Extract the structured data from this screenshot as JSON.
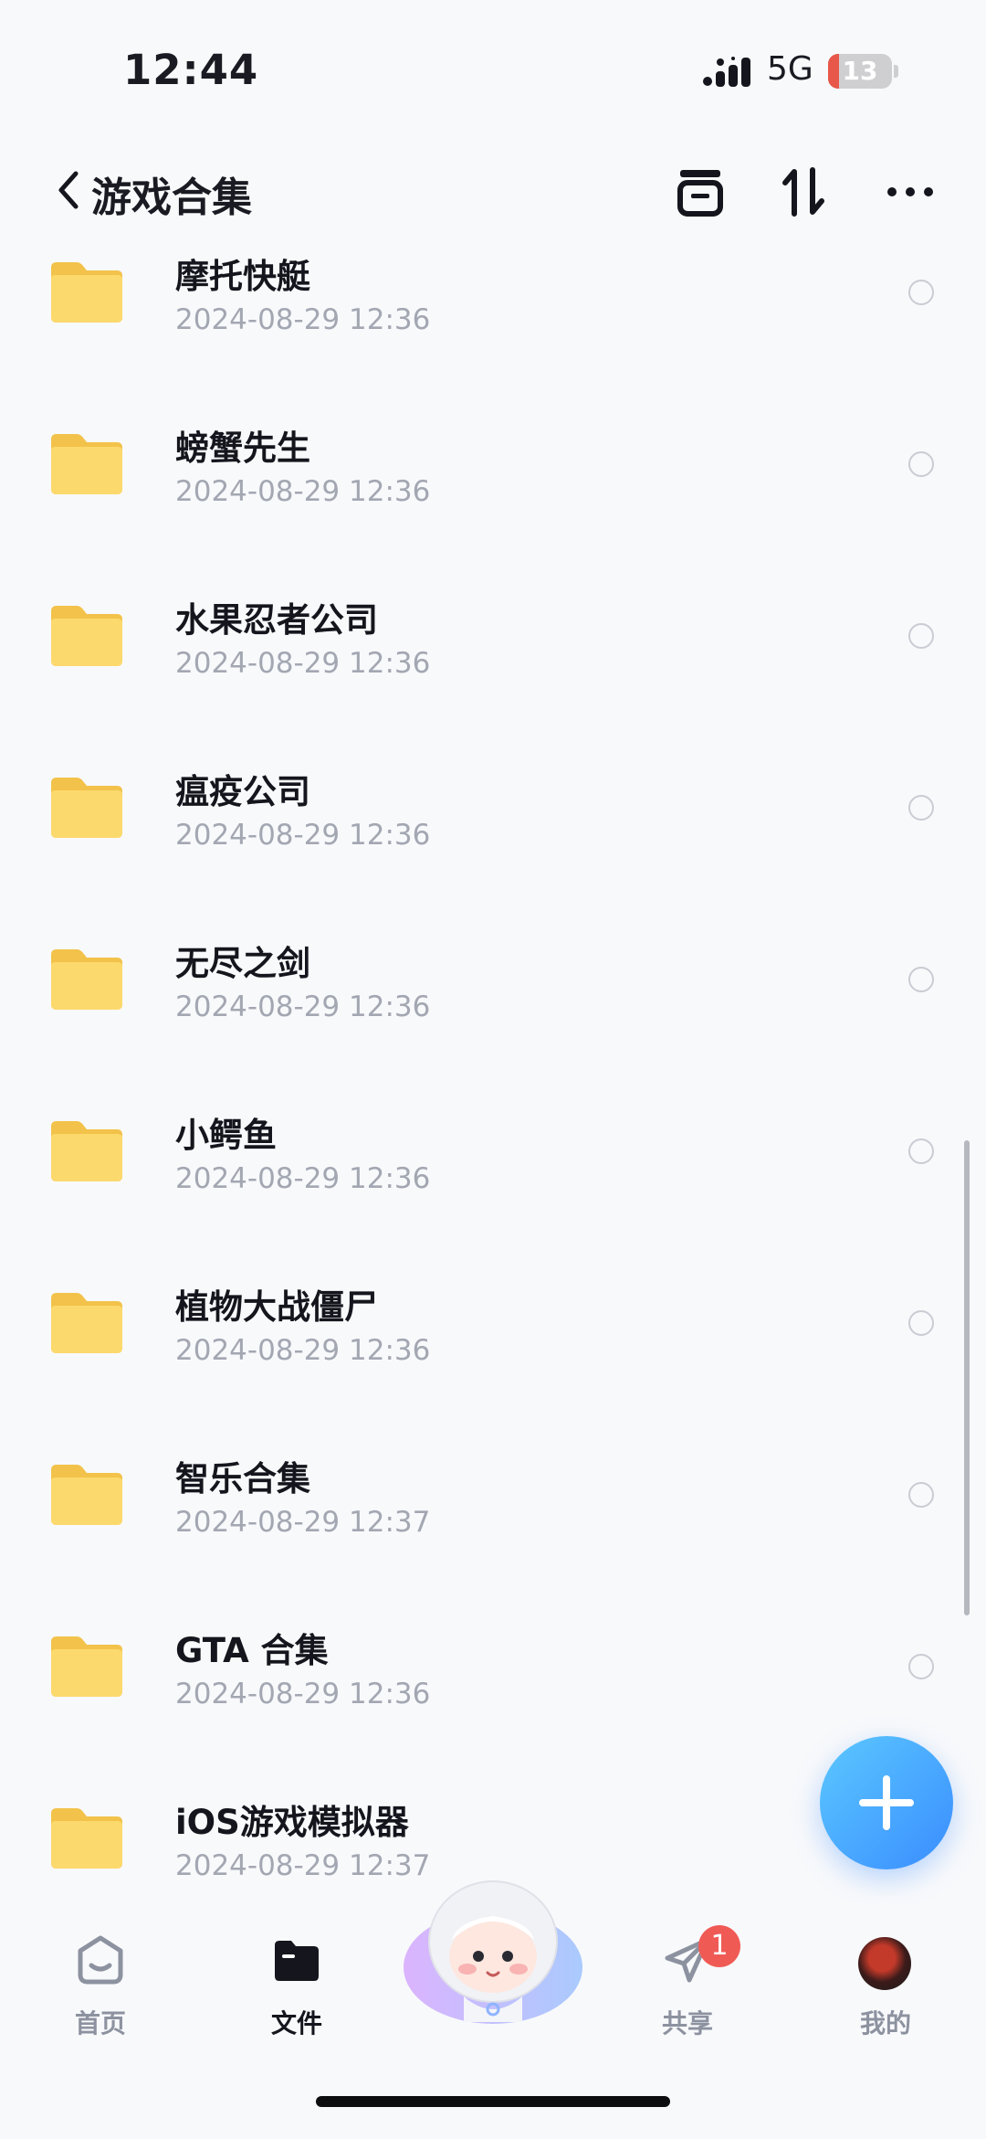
{
  "status_bar": {
    "time": "12:44",
    "network": "5G",
    "battery": "13"
  },
  "nav": {
    "title": "游戏合集",
    "icons": [
      "back-icon",
      "archive-icon",
      "sort-icon",
      "more-icon"
    ]
  },
  "files": [
    {
      "name": "摩托快艇",
      "date": "2024-08-29 12:36"
    },
    {
      "name": "螃蟹先生",
      "date": "2024-08-29 12:36"
    },
    {
      "name": "水果忍者公司",
      "date": "2024-08-29 12:36"
    },
    {
      "name": "瘟疫公司",
      "date": "2024-08-29 12:36"
    },
    {
      "name": "无尽之剑",
      "date": "2024-08-29 12:36"
    },
    {
      "name": "小鳄鱼",
      "date": "2024-08-29 12:36"
    },
    {
      "name": "植物大战僵尸",
      "date": "2024-08-29 12:36"
    },
    {
      "name": "智乐合集",
      "date": "2024-08-29 12:37"
    },
    {
      "name": "GTA 合集",
      "date": "2024-08-29 12:36"
    },
    {
      "name": "iOS游戏模拟器",
      "date": "2024-08-29 12:37"
    }
  ],
  "tabs": {
    "home": "首页",
    "files": "文件",
    "share": "共享",
    "share_badge": "1",
    "mine": "我的",
    "active": "files"
  },
  "colors": {
    "folder": "#f9d463",
    "accent": "#3a8dff",
    "badge": "#f05a55"
  }
}
